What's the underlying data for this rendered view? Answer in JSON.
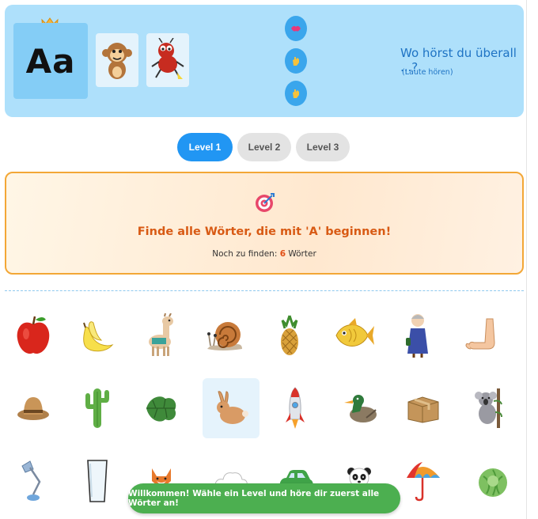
{
  "header": {
    "letter": "Aa",
    "question": "Wo hörst du überall ...?",
    "sub": "(Laute hören)"
  },
  "levels": [
    {
      "label": "Level 1",
      "active": true
    },
    {
      "label": "Level 2",
      "active": false
    },
    {
      "label": "Level 3",
      "active": false
    }
  ],
  "task": {
    "text": "Finde alle Wörter, die mit 'A' beginnen!",
    "count_prefix": "Noch zu finden:",
    "count": "6",
    "count_suffix": "Wörter"
  },
  "grid": [
    [
      "apple-icon",
      "banana-icon",
      "llama-icon",
      "snail-icon",
      "pineapple-icon",
      "fish-icon",
      "grandma-icon",
      "arm-icon"
    ],
    [
      "hat-icon",
      "cactus-icon",
      "leaf-icon",
      "rabbit-icon",
      "rocket-icon",
      "duck-icon",
      "package-icon",
      "koala-icon"
    ],
    [
      "lamp-icon",
      "glass-icon",
      "fox-icon",
      "cloud-icon",
      "car-icon",
      "panda-icon",
      "umbrella-icon",
      "lettuce-icon"
    ]
  ],
  "colors": {
    "header_bg": "#aee0fb",
    "accent": "#2196f3",
    "task_border": "#f3a736",
    "task_text": "#d85a14",
    "toast_bg": "#4caf50"
  },
  "toast": "Willkommen! Wähle ein Level und höre dir zuerst alle Wörter an!"
}
